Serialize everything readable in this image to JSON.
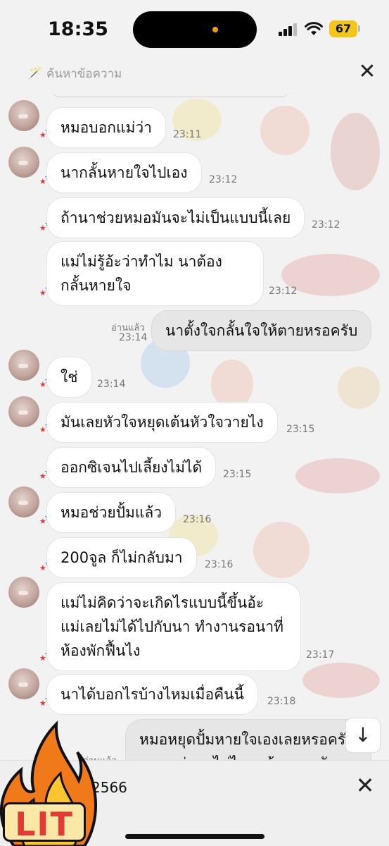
{
  "status_bar": {
    "time": "18:35",
    "battery": "67"
  },
  "search": {
    "placeholder": "ค้นหาข้อความ",
    "icon": "magic-wand-icon"
  },
  "messages": [
    {
      "side": "left",
      "text": "หมอบอกแม่ว่า",
      "time": "23:11"
    },
    {
      "side": "left",
      "text": "นากลั้นหายใจไปเอง",
      "time": "23:12"
    },
    {
      "side": "left",
      "text": "ถ้านาช่วยหมอมันจะไม่เป็นแบบนี้เลย",
      "time": "23:12"
    },
    {
      "side": "left",
      "text": "แม่ไม่รู้อ้ะว่าทำไม นาต้องกลั้นหายใจ",
      "time": "23:12"
    },
    {
      "side": "right",
      "text": "นาตั้งใจกลั้นใจให้ตายหรอครับ",
      "read": "อ่านแล้ว",
      "time": "23:14"
    },
    {
      "side": "left",
      "text": "ใช่",
      "time": "23:14"
    },
    {
      "side": "left",
      "text": "มันเลยหัวใจหยุดเต้นหัวใจวายไง",
      "time": "23:15"
    },
    {
      "side": "left",
      "text": "ออกซิเจนไปเลี้ยงไม่ได้",
      "time": "23:15"
    },
    {
      "side": "left",
      "text": "หมอช่วยปั้มแล้ว",
      "time": "23:16"
    },
    {
      "side": "left",
      "text": "200จูล ก็ไม่กลับมา",
      "time": "23:16"
    },
    {
      "side": "left",
      "text": "แม่ไม่คิดว่าจะเกิดไรแบบนี้ขึ้นอ้ะ แม่เลยไม่ได้ไปกับนา ทำงานรอนาที่ห้องพักฟื้นไง",
      "time": "23:17"
    },
    {
      "side": "left",
      "text": "นาได้บอกไรบ้างไหมเมื่อคืนนี้",
      "time": "23:18"
    },
    {
      "side": "right",
      "text": "หมอหยุดปั้มหายใจเองเลยหรอครับ เพราะว่านาไม่ไหวแล้วหรอครับ",
      "read": "อ่านแล้ว"
    }
  ],
  "bottom_bar": {
    "text": "2566"
  },
  "sticker": {
    "text": "LIT",
    "icon": "fire-icon"
  },
  "colors": {
    "accent_star_red": "#e53935",
    "accent_star_yellow": "#f5c518",
    "accent_star_blue": "#1e63d6",
    "bubble_me": "#e6e6e6"
  }
}
